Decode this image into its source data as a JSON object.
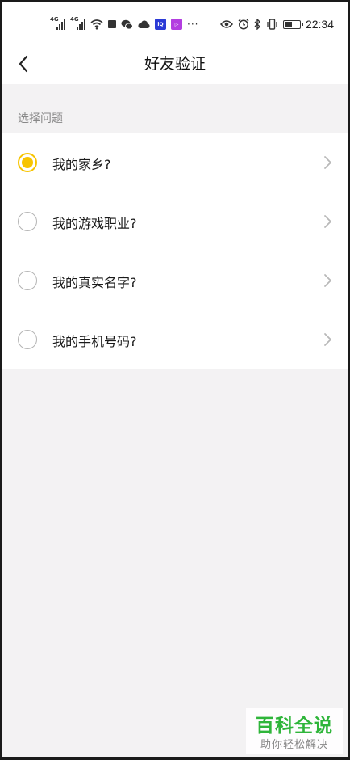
{
  "status_bar": {
    "network_1": "4G",
    "network_2": "4G",
    "more": "···",
    "time": "22:34",
    "battery_level": 0.55,
    "app_icons": [
      "wifi-icon",
      "square-notification-icon",
      "wechat-icon",
      "cloud-icon",
      "app-box-icon",
      "video-app-icon"
    ],
    "right_icons": [
      "eye-icon",
      "alarm-icon",
      "bluetooth-icon",
      "vibrate-icon",
      "battery-icon"
    ]
  },
  "nav": {
    "title": "好友验证",
    "back_icon": "chevron-left-icon"
  },
  "section": {
    "header": "选择问题"
  },
  "questions": [
    {
      "label": "我的家乡?",
      "selected": true
    },
    {
      "label": "我的游戏职业?",
      "selected": false
    },
    {
      "label": "我的真实名字?",
      "selected": false
    },
    {
      "label": "我的手机号码?",
      "selected": false
    }
  ],
  "watermark": {
    "title": "百科全说",
    "subtitle": "助你轻松解决"
  },
  "colors": {
    "accent": "#f7c400",
    "background": "#f3f2f3",
    "card": "#ffffff",
    "watermark": "#2fb53a"
  }
}
